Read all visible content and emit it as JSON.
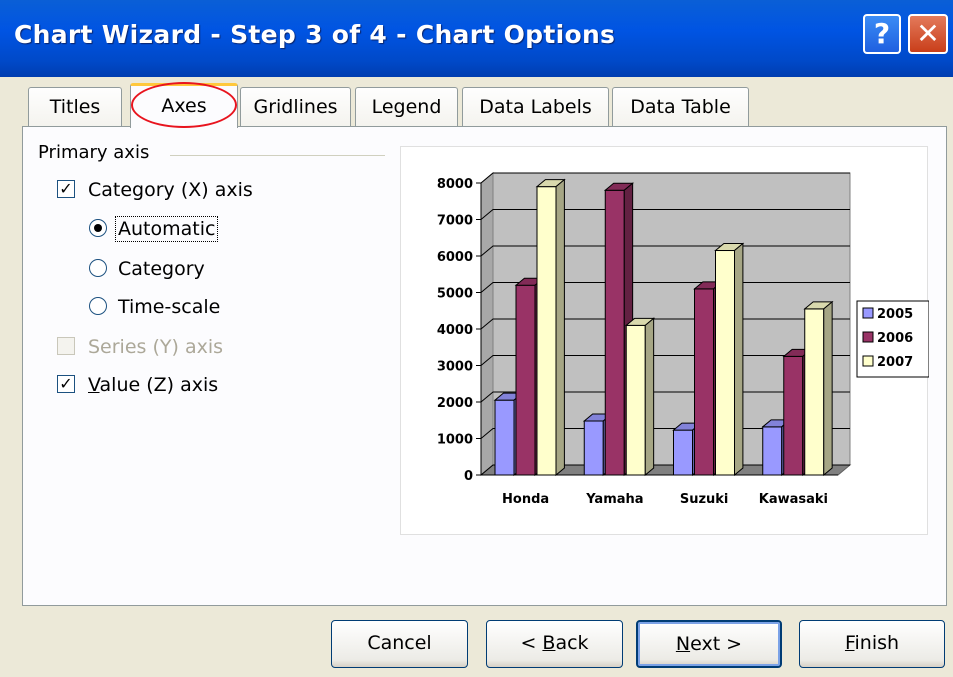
{
  "window": {
    "title": "Chart Wizard - Step 3 of 4 - Chart Options",
    "help_glyph": "?",
    "close_glyph": "✕"
  },
  "tabs": [
    {
      "label": "Titles",
      "active": false
    },
    {
      "label": "Axes",
      "active": true
    },
    {
      "label": "Gridlines",
      "active": false
    },
    {
      "label": "Legend",
      "active": false
    },
    {
      "label": "Data Labels",
      "active": false
    },
    {
      "label": "Data Table",
      "active": false
    }
  ],
  "axes_panel": {
    "group_label": "Primary axis",
    "category_x": {
      "label": "Category (X) axis",
      "checked": true
    },
    "radio_automatic": {
      "label": "Automatic",
      "selected": true
    },
    "radio_category": {
      "label": "Category",
      "selected": false
    },
    "radio_timescale": {
      "label": "Time-scale",
      "selected": false
    },
    "series_y": {
      "label": "Series (Y) axis",
      "checked": false,
      "disabled": true
    },
    "value_z": {
      "label_prefix": "V",
      "label_rest": "alue (Z) axis",
      "checked": true
    }
  },
  "chart_data": {
    "type": "bar",
    "categories": [
      "Honda",
      "Yamaha",
      "Suzuki",
      "Kawasaki"
    ],
    "series": [
      {
        "name": "2005",
        "values": [
          2050,
          1480,
          1230,
          1320
        ],
        "color": "#9999ff"
      },
      {
        "name": "2006",
        "values": [
          5200,
          7800,
          5100,
          3250
        ],
        "color": "#993366"
      },
      {
        "name": "2007",
        "values": [
          7900,
          4100,
          6150,
          4550
        ],
        "color": "#ffffcc"
      }
    ],
    "ylim": [
      0,
      8000
    ],
    "yticks": [
      "0",
      "1000",
      "2000",
      "3000",
      "4000",
      "5000",
      "6000",
      "7000",
      "8000"
    ],
    "grid": true,
    "legend_position": "right",
    "legend_labels": [
      "2005",
      "2006",
      "2007"
    ],
    "wall_color": "#c0c0c0"
  },
  "buttons": {
    "cancel": "Cancel",
    "back_prefix": "< ",
    "back_hot": "B",
    "back_rest": "ack",
    "next_hot": "N",
    "next_rest": "ext >",
    "finish_hot": "F",
    "finish_rest": "inish"
  },
  "annotation": {
    "color": "#e8141e"
  }
}
